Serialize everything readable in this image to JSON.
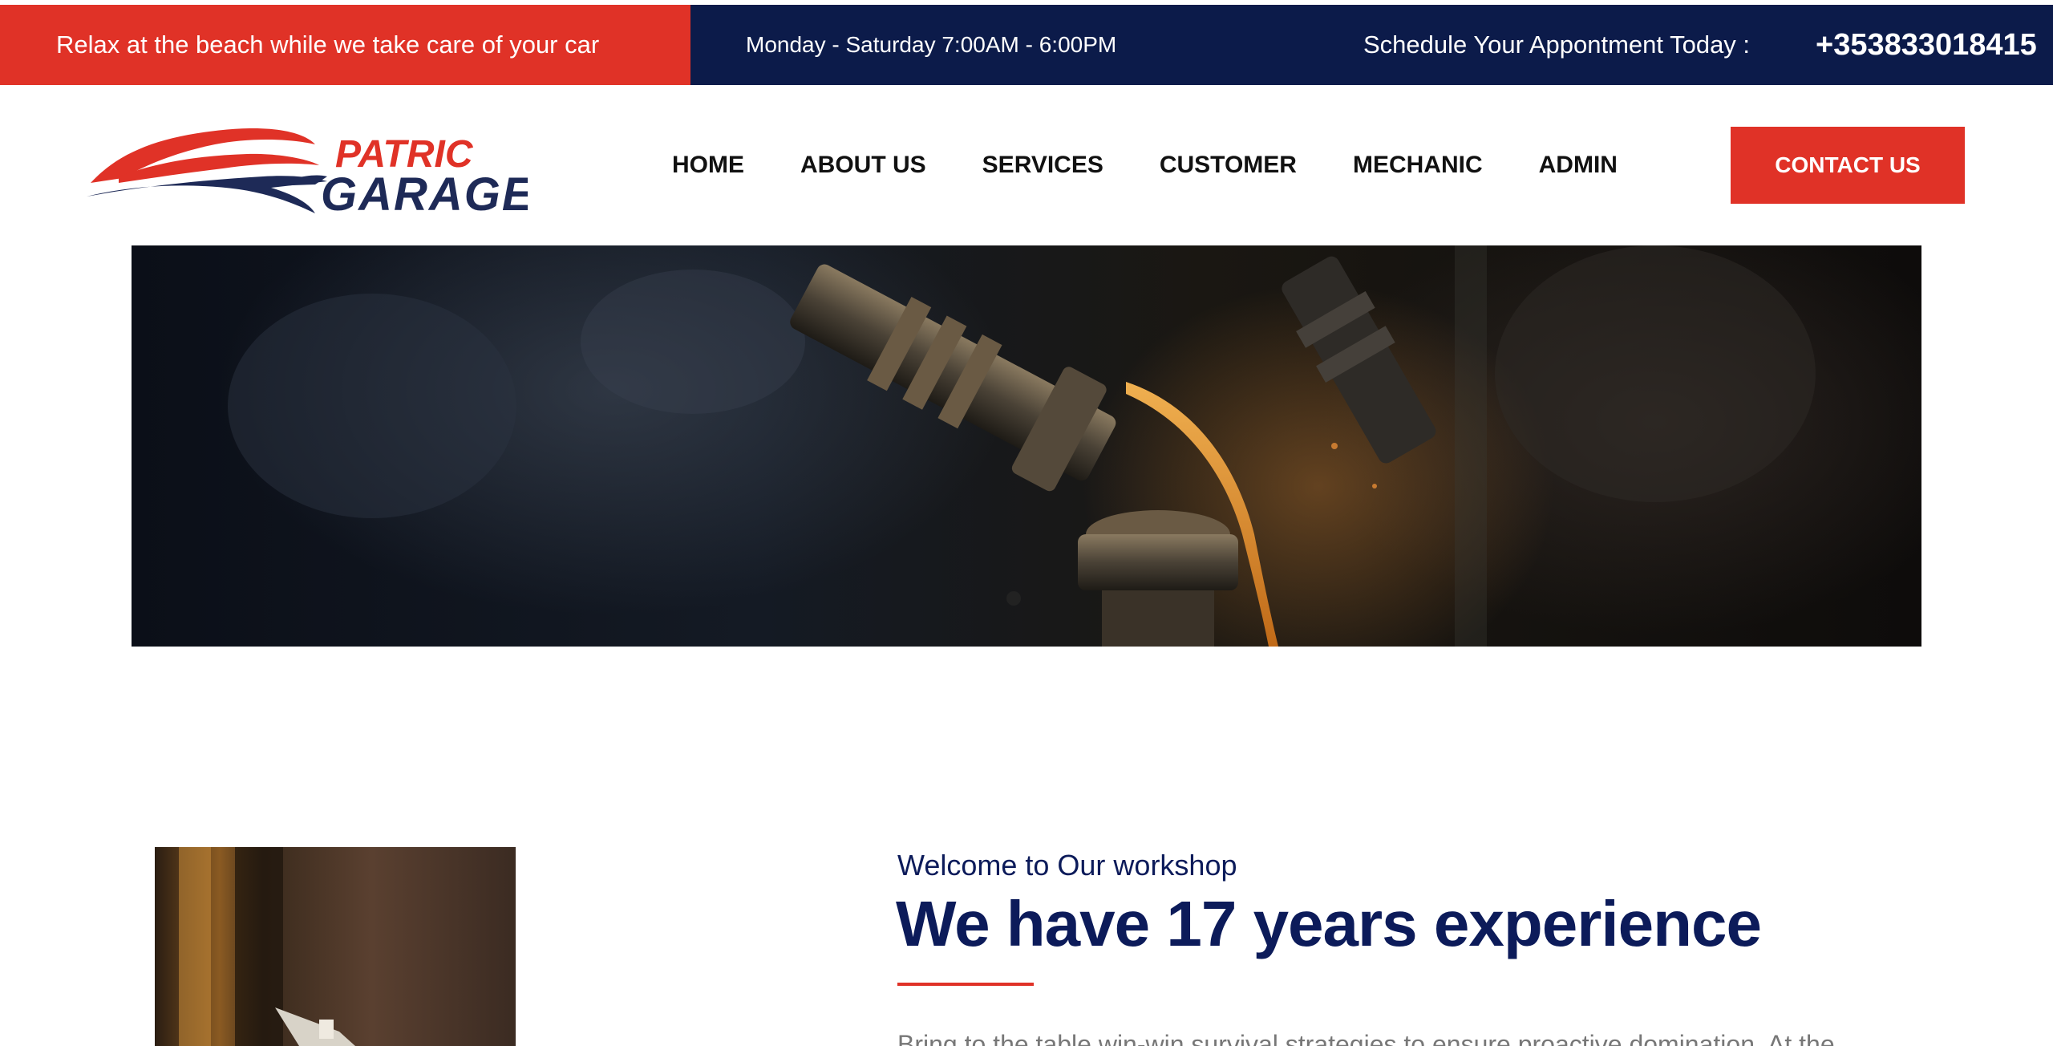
{
  "topbar": {
    "promo": "Relax at the beach while we take care of your car",
    "hours": "Monday - Saturday 7:00AM - 6:00PM",
    "schedule_label": "Schedule Your Appontment Today :",
    "phone": "+353833018415"
  },
  "logo": {
    "line1": "PATRIC",
    "line2": "GARAGE"
  },
  "nav": {
    "items": [
      {
        "label": "HOME"
      },
      {
        "label": "ABOUT US"
      },
      {
        "label": "SERVICES"
      },
      {
        "label": "CUSTOMER"
      },
      {
        "label": "MECHANIC"
      },
      {
        "label": "ADMIN"
      }
    ],
    "cta": "CONTACT US"
  },
  "welcome": {
    "kicker": "Welcome to Our workshop",
    "headline": "We have 17 years experience",
    "body": "Bring to the table win-win survival strategies to ensure proactive domination. At the"
  },
  "colors": {
    "accent": "#e03227",
    "navy": "#0c1b4a",
    "headline": "#0c1b5a"
  }
}
